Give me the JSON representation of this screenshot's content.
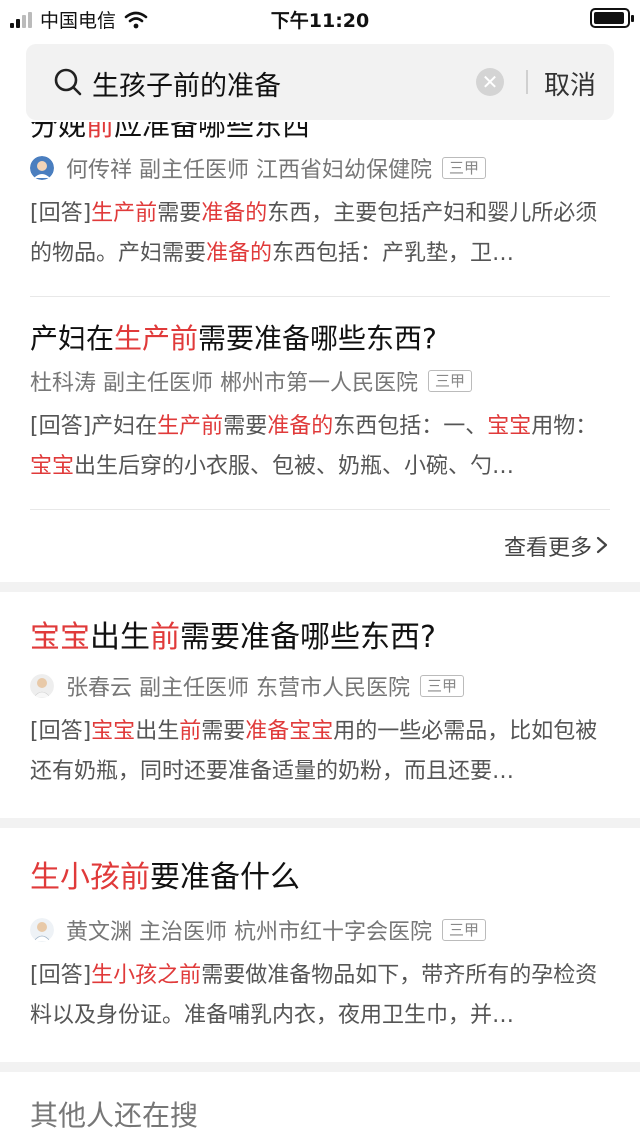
{
  "status_bar": {
    "carrier": "中国电信",
    "time": "下午11:20",
    "battery_level": 0.95
  },
  "search": {
    "query": "生孩子前的准备",
    "clear_glyph": "✕",
    "cancel_label": "取消"
  },
  "results_group": {
    "items": [
      {
        "title_segments": [
          {
            "text": "分娩",
            "hl": false
          },
          {
            "text": "前",
            "hl": true
          },
          {
            "text": "应准备哪些东西",
            "hl": false
          }
        ],
        "doctor": "何传祥 副主任医师 江西省妇幼保健院",
        "badge": "三甲",
        "answer_segments": [
          {
            "text": "[回答]",
            "hl": false
          },
          {
            "text": "生产前",
            "hl": true
          },
          {
            "text": "需要",
            "hl": false
          },
          {
            "text": "准备的",
            "hl": true
          },
          {
            "text": "东西，主要包括产妇和婴儿所必须的物品。产妇需要",
            "hl": false
          },
          {
            "text": "准备的",
            "hl": true
          },
          {
            "text": "东西包括：产乳垫，卫…",
            "hl": false
          }
        ]
      },
      {
        "title_segments": [
          {
            "text": "产妇在",
            "hl": false
          },
          {
            "text": "生产前",
            "hl": true
          },
          {
            "text": "需要准备哪些东西?",
            "hl": false
          }
        ],
        "doctor": "杜科涛 副主任医师 郴州市第一人民医院",
        "badge": "三甲",
        "answer_segments": [
          {
            "text": "[回答]产妇在",
            "hl": false
          },
          {
            "text": "生产前",
            "hl": true
          },
          {
            "text": "需要",
            "hl": false
          },
          {
            "text": "准备的",
            "hl": true
          },
          {
            "text": "东西包括：一、",
            "hl": false
          },
          {
            "text": "宝宝",
            "hl": true
          },
          {
            "text": "用物：",
            "hl": false
          },
          {
            "text": "宝宝",
            "hl": true
          },
          {
            "text": "出生后穿的小衣服、包被、奶瓶、小碗、勺…",
            "hl": false
          }
        ]
      }
    ],
    "more_label": "查看更多"
  },
  "result_cards": [
    {
      "title_segments": [
        {
          "text": "宝宝",
          "hl": true
        },
        {
          "text": "出生",
          "hl": false
        },
        {
          "text": "前",
          "hl": true
        },
        {
          "text": "需要准备哪些东西?",
          "hl": false
        }
      ],
      "doctor": "张春云 副主任医师 东营市人民医院",
      "badge": "三甲",
      "answer_segments": [
        {
          "text": "[回答]",
          "hl": false
        },
        {
          "text": "宝宝",
          "hl": true
        },
        {
          "text": "出生",
          "hl": false
        },
        {
          "text": "前",
          "hl": true
        },
        {
          "text": "需要",
          "hl": false
        },
        {
          "text": "准备宝宝",
          "hl": true
        },
        {
          "text": "用的一些必需品，比如包被还有奶瓶，同时还要准备适量的奶粉，而且还要…",
          "hl": false
        }
      ]
    },
    {
      "title_segments": [
        {
          "text": "生小孩前",
          "hl": true
        },
        {
          "text": "要准备什么",
          "hl": false
        }
      ],
      "doctor": "黄文渊 主治医师 杭州市红十字会医院",
      "badge": "三甲",
      "answer_segments": [
        {
          "text": "[回答]",
          "hl": false
        },
        {
          "text": "生小孩之前",
          "hl": true
        },
        {
          "text": "需要做准备物品如下，带齐所有的孕检资料以及身份证。准备哺乳内衣，夜用卫生巾，并…",
          "hl": false
        }
      ]
    }
  ],
  "others_title": "其他人还在搜",
  "colors": {
    "highlight": "#e03a3a",
    "search_bg": "#f2f2f2",
    "divider": "#f2f2f2"
  }
}
